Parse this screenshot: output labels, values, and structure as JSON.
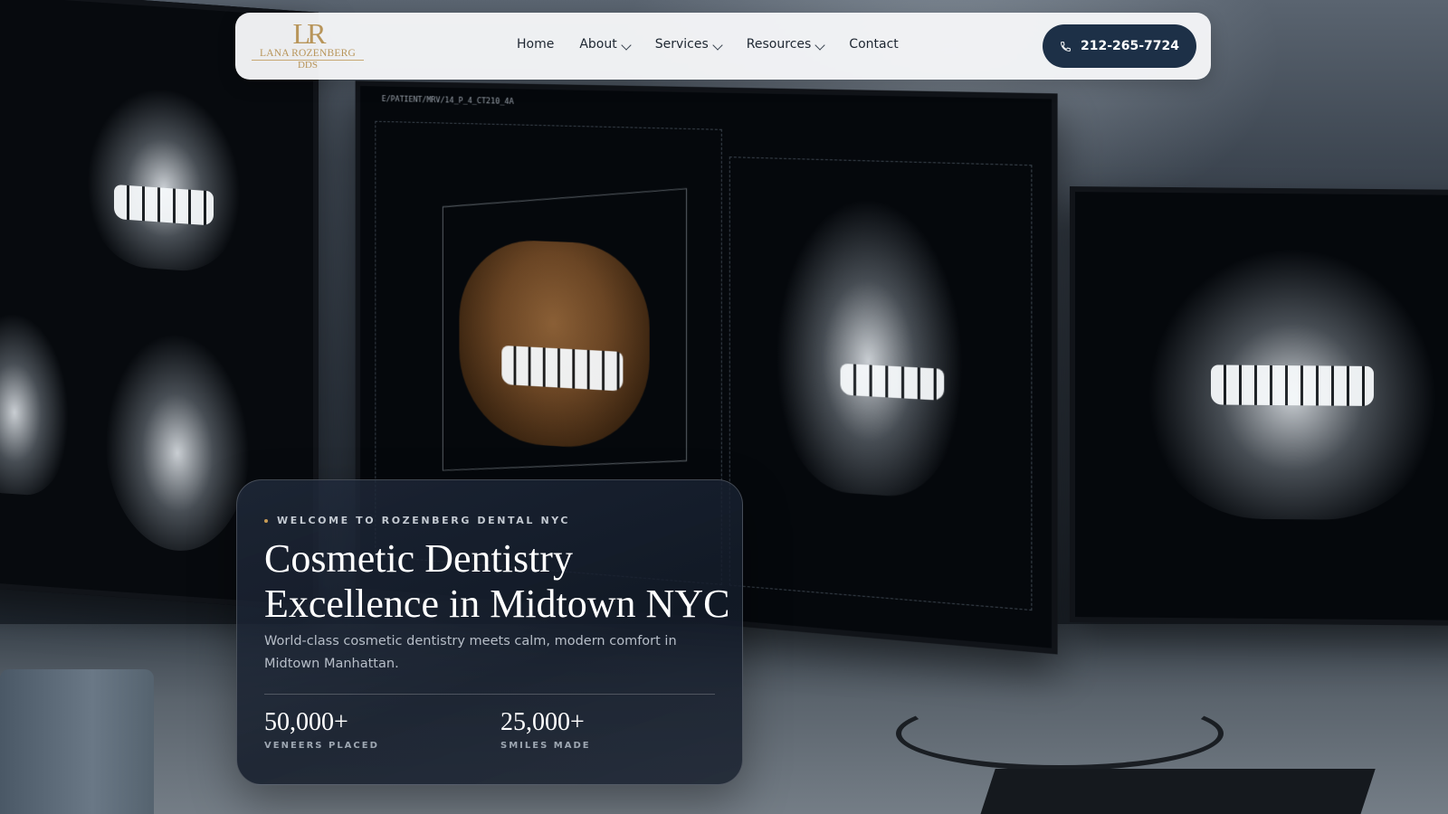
{
  "brand": {
    "logo_mark": "LR",
    "name": "LANA ROZENBERG",
    "suffix": "DDS",
    "accent_color": "#b8955a"
  },
  "nav": {
    "items": [
      {
        "label": "Home",
        "has_dropdown": false
      },
      {
        "label": "About",
        "has_dropdown": true
      },
      {
        "label": "Services",
        "has_dropdown": true
      },
      {
        "label": "Resources",
        "has_dropdown": true
      },
      {
        "label": "Contact",
        "has_dropdown": false
      }
    ],
    "phone": "212-265-7724",
    "phone_icon": "phone-icon",
    "button_color": "#1d3047"
  },
  "hero": {
    "eyebrow": "WELCOME TO ROZENBERG DENTAL NYC",
    "headline_line1": "Cosmetic Dentistry",
    "headline_line2": "Excellence in Midtown NYC",
    "subhead": "World-class cosmetic dentistry meets calm, modern comfort in Midtown Manhattan.",
    "stats": [
      {
        "value": "50,000+",
        "label": "VENEERS PLACED"
      },
      {
        "value": "25,000+",
        "label": "SMILES MADE"
      }
    ]
  },
  "background": {
    "scan_header": "E/PATIENT/MRV/14_P_4_CT210_4A"
  }
}
